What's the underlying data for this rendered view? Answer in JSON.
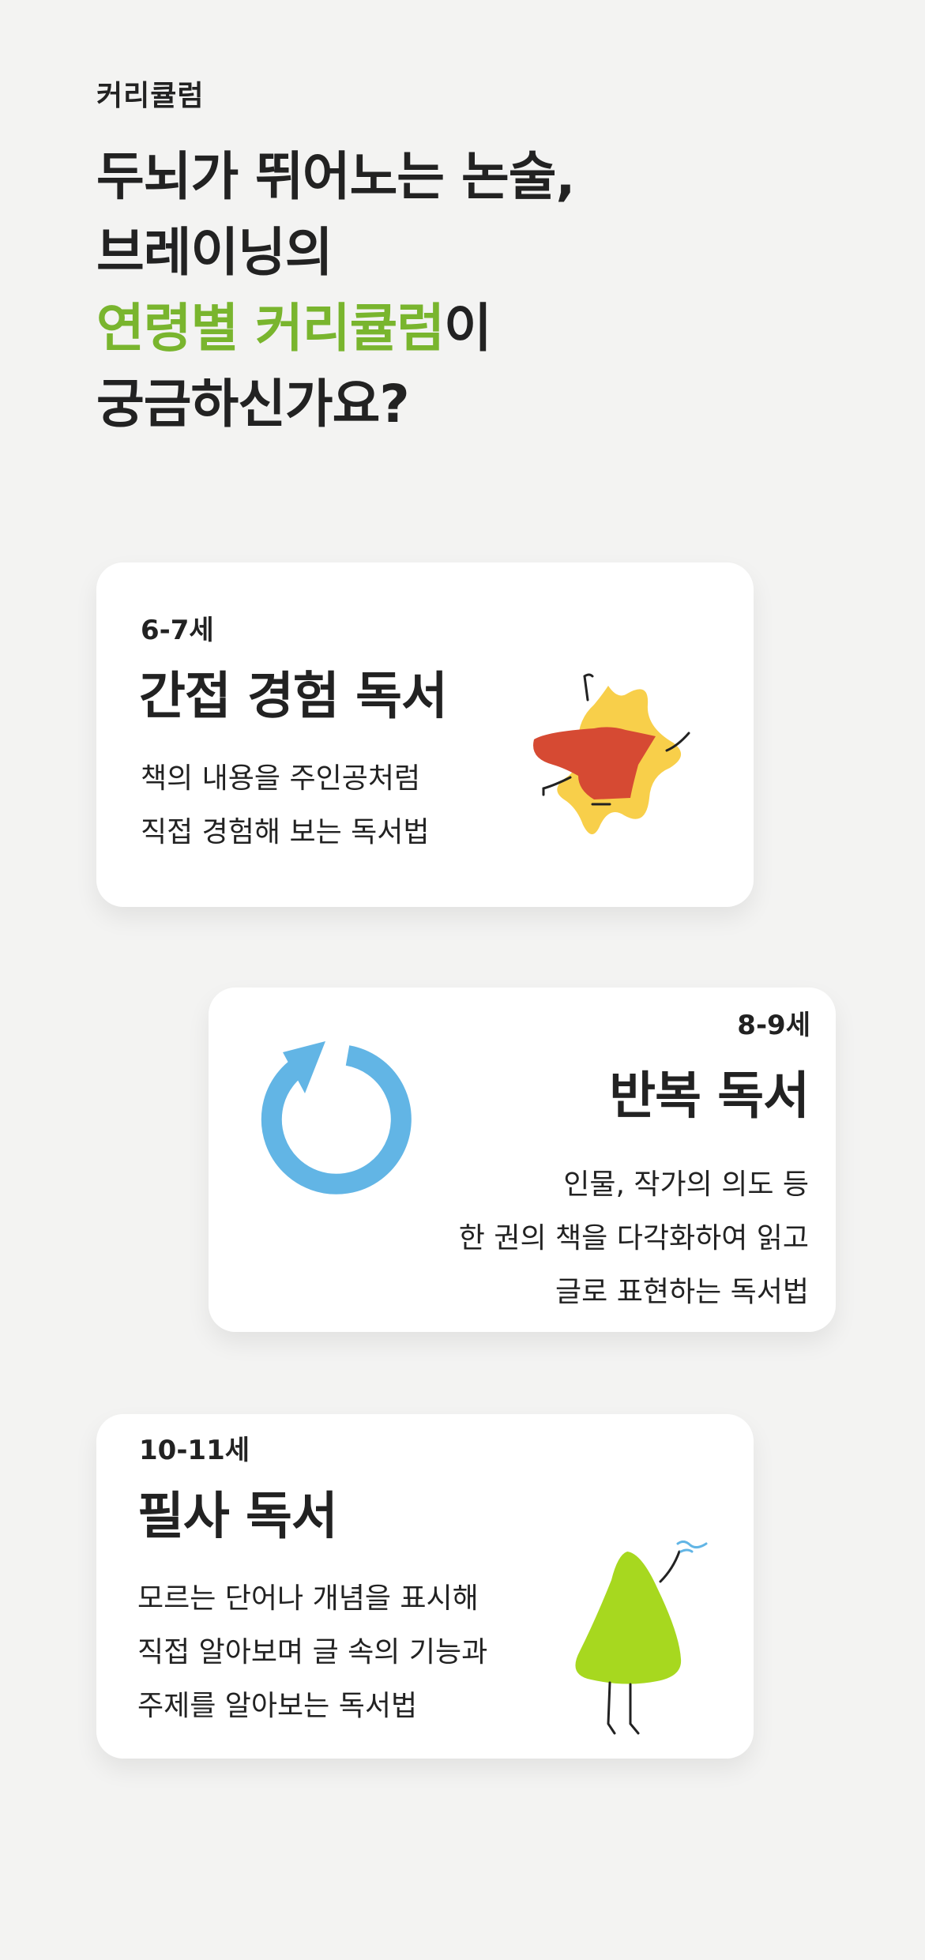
{
  "header": {
    "section_label": "커리큘럼",
    "headline_line1": "두뇌가 뛰어노는 논술,",
    "headline_line2": "브레이닝의",
    "headline_accent": "연령별 커리큘럼",
    "headline_line3_suffix": "이",
    "headline_line4": "궁금하신가요?"
  },
  "colors": {
    "accent_green": "#79b52e",
    "background": "#f3f3f2",
    "card": "#ffffff",
    "star_yellow": "#f8cf4a",
    "cape_red": "#d64a33",
    "circle_blue": "#62b5e5",
    "blob_green": "#a7d81f"
  },
  "cards": [
    {
      "age": "6-7세",
      "title": "간접 경험 독서",
      "desc": [
        "책의 내용을 주인공처럼",
        "직접 경험해 보는 독서법"
      ],
      "icon": "star-character-icon"
    },
    {
      "age": "8-9세",
      "title": "반복 독서",
      "desc": [
        "인물, 작가의 의도 등",
        "한 권의 책을 다각화하여 읽고",
        "글로 표현하는 독서법"
      ],
      "icon": "circular-arrow-icon"
    },
    {
      "age": "10-11세",
      "title": "필사 독서",
      "desc": [
        "모르는 단어나 개념을 표시해",
        "직접 알아보며 글 속의 기능과",
        "주제를 알아보는 독서법"
      ],
      "icon": "green-blob-character-icon"
    }
  ]
}
